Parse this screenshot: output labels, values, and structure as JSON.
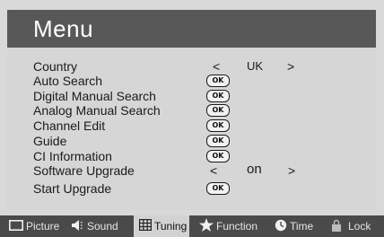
{
  "header": {
    "title": "Menu"
  },
  "menu": {
    "items": [
      {
        "label": "Country",
        "prev": "<",
        "value": "UK",
        "next": ">"
      },
      {
        "label": "Auto Search",
        "button": "OK"
      },
      {
        "label": "Digital Manual Search",
        "button": "OK"
      },
      {
        "label": "Analog Manual Search",
        "button": "OK"
      },
      {
        "label": "Channel Edit",
        "button": "OK"
      },
      {
        "label": "Guide",
        "button": "OK"
      },
      {
        "label": "CI Information",
        "button": "OK"
      },
      {
        "label": "Software Upgrade",
        "prev": "<",
        "value": "on",
        "next": ">"
      },
      {
        "label": "Start Upgrade",
        "button": "OK"
      }
    ]
  },
  "tabs": [
    {
      "label": "Picture",
      "icon": "monitor-icon"
    },
    {
      "label": "Sound",
      "icon": "speaker-icon"
    },
    {
      "label": "Tuning",
      "icon": "grid-icon",
      "active": true
    },
    {
      "label": "Function",
      "icon": "star-icon"
    },
    {
      "label": "Time",
      "icon": "clock-icon"
    },
    {
      "label": "Lock",
      "icon": "lock-icon"
    }
  ],
  "colors": {
    "title_bar": "#585858",
    "panel": "#d6d6d6",
    "bottom_bar": "#4a4a4a",
    "active_tab": "#d2d2d2"
  }
}
